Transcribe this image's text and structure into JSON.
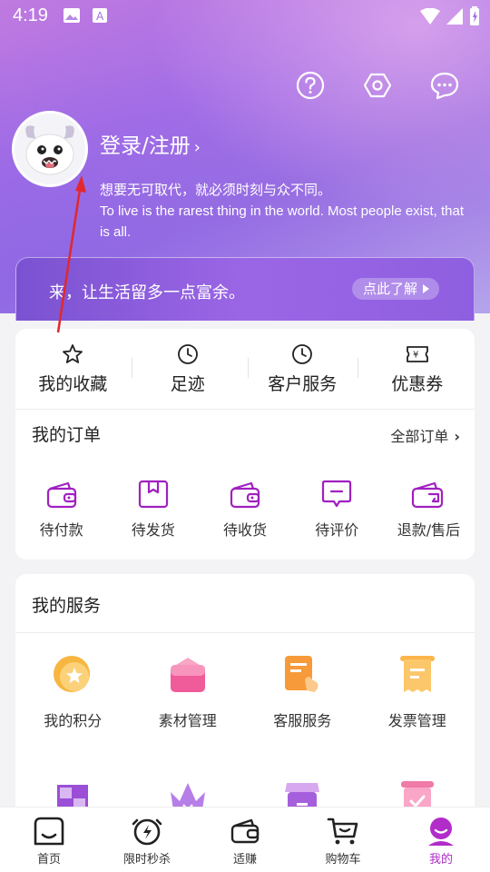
{
  "status": {
    "time": "4:19"
  },
  "header": {
    "icons": [
      "help-icon",
      "settings-icon",
      "message-icon"
    ],
    "login_label": "登录/注册",
    "login_arrow": "›",
    "motto_cn": "想要无可取代，就必须时刻与众不同。",
    "motto_en": "To live is the rarest thing in the world. Most people exist, that is all."
  },
  "promo": {
    "text": "来，让生活留多一点富余。",
    "button": "点此了解"
  },
  "quick": [
    {
      "label": "我的收藏",
      "icon": "star-icon"
    },
    {
      "label": "足迹",
      "icon": "clock-icon"
    },
    {
      "label": "客户服务",
      "icon": "clock-icon"
    },
    {
      "label": "优惠券",
      "icon": "coupon-icon"
    }
  ],
  "orders": {
    "title": "我的订单",
    "more": "全部订单",
    "more_arrow": "›",
    "items": [
      {
        "label": "待付款",
        "icon": "wallet-icon"
      },
      {
        "label": "待发货",
        "icon": "box-icon"
      },
      {
        "label": "待收货",
        "icon": "wallet-icon"
      },
      {
        "label": "待评价",
        "icon": "comment-icon"
      },
      {
        "label": "退款/售后",
        "icon": "refund-icon"
      }
    ]
  },
  "services": {
    "title": "我的服务",
    "items": [
      {
        "label": "我的积分",
        "icon": "points-icon"
      },
      {
        "label": "素材管理",
        "icon": "folder-icon"
      },
      {
        "label": "客服服务",
        "icon": "support-icon"
      },
      {
        "label": "发票管理",
        "icon": "invoice-icon"
      },
      {
        "label": "",
        "icon": "grid-icon"
      },
      {
        "label": "",
        "icon": "crown-icon"
      },
      {
        "label": "",
        "icon": "store-icon"
      },
      {
        "label": "",
        "icon": "check-box-icon"
      }
    ]
  },
  "tabs": [
    {
      "label": "首页",
      "icon": "home-icon"
    },
    {
      "label": "限时秒杀",
      "icon": "flash-clock-icon"
    },
    {
      "label": "适赚",
      "icon": "wallet-icon"
    },
    {
      "label": "购物车",
      "icon": "cart-icon"
    },
    {
      "label": "我的",
      "icon": "profile-icon",
      "active": true
    }
  ],
  "colors": {
    "accent": "#b12cc9",
    "hero": "#a46ee6"
  }
}
